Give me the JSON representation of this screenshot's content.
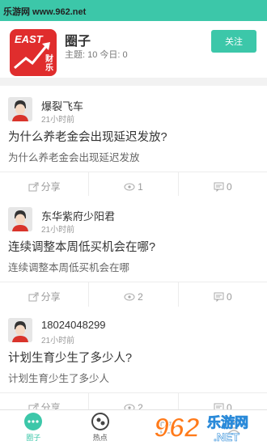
{
  "status_bar": {
    "watermark": "乐游网 www.962.net"
  },
  "circle": {
    "logo_text": "EAST",
    "logo_sub": "财乐",
    "name": "圈子",
    "meta": "主题: 10  今日: 0",
    "follow_label": "关注"
  },
  "posts": [
    {
      "author": "爆裂飞车",
      "time": "21小时前",
      "title": "为什么养老金会出现延迟发放?",
      "excerpt": "为什么养老金会出现延迟发放",
      "share_label": "分享",
      "views": "1",
      "comments": "0"
    },
    {
      "author": "东华紫府少阳君",
      "time": "21小时前",
      "title": "连续调整本周低买机会在哪?",
      "excerpt": "连续调整本周低买机会在哪",
      "share_label": "分享",
      "views": "2",
      "comments": "0"
    },
    {
      "author": "18024048299",
      "time": "21小时前",
      "title": "计划生育少生了多少人?",
      "excerpt": "计划生育少生了多少人",
      "share_label": "分享",
      "views": "2",
      "comments": "0"
    }
  ],
  "bottom_nav": {
    "items": [
      {
        "label": "圈子",
        "icon": "chat-bubble-icon"
      },
      {
        "label": "热点",
        "icon": "hot-ball-icon"
      },
      {
        "label": "",
        "icon": "compose-icon"
      },
      {
        "label": "",
        "icon": "profile-icon"
      }
    ]
  },
  "watermark_bottom": {
    "number": "962",
    "text": "乐游网",
    "url": ".NET"
  },
  "colors": {
    "accent": "#3cc7a9",
    "logo_red": "#e02d2d"
  }
}
